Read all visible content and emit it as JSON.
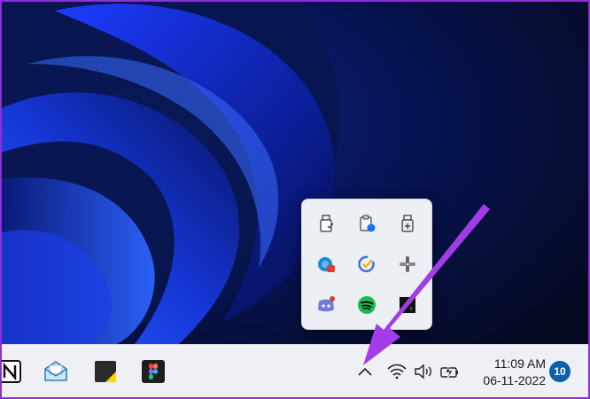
{
  "screen": {
    "wallpaper": "windows-11-bloom-dark",
    "accent_color": "#1f4fe0"
  },
  "tray_flyout": {
    "items": [
      {
        "icon": "usb-drive-icon"
      },
      {
        "icon": "clipboard-sync-icon"
      },
      {
        "icon": "usb-eject-icon"
      },
      {
        "icon": "edge-red-badge-icon"
      },
      {
        "icon": "todo-check-icon"
      },
      {
        "icon": "slack-icon"
      },
      {
        "icon": "discord-icon"
      },
      {
        "icon": "spotify-icon"
      },
      {
        "icon": "app-black-square-icon"
      }
    ]
  },
  "taskbar": {
    "apps": [
      {
        "name": "Notion",
        "icon": "notion-icon"
      },
      {
        "name": "Mail",
        "icon": "mail-icon"
      },
      {
        "name": "Sticky Notes",
        "icon": "sticky-notes-icon"
      },
      {
        "name": "Figma",
        "icon": "figma-icon"
      }
    ],
    "tray": {
      "chevron_icon": "chevron-up-icon",
      "wifi_icon": "wifi-icon",
      "volume_icon": "volume-icon",
      "battery_icon": "battery-charging-icon"
    },
    "clock": {
      "time": "11:09 AM",
      "date": "06-11-2022"
    },
    "notification_count": "10"
  },
  "annotation": {
    "arrow_color": "#a13ce8"
  }
}
